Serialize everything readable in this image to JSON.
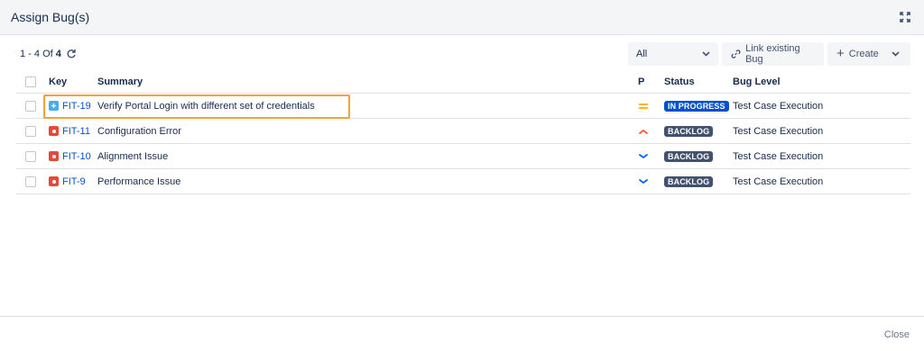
{
  "dialog": {
    "title": "Assign Bug(s)"
  },
  "toolbar": {
    "count_prefix": "1 - 4 Of",
    "count_total": "4",
    "filter_value": "All",
    "link_label": "Link existing Bug",
    "create_label": "Create"
  },
  "table": {
    "headers": {
      "key": "Key",
      "summary": "Summary",
      "p": "P",
      "status": "Status",
      "level": "Bug Level"
    },
    "rows": [
      {
        "key": "FIT-19",
        "summary": "Verify Portal Login with different set of credentials",
        "status": "IN PROGRESS",
        "level": "Test Case Execution",
        "type_icon": "task-icon",
        "priority_icon": "priority-medium-icon"
      },
      {
        "key": "FIT-11",
        "summary": "Configuration Error",
        "status": "BACKLOG",
        "level": "Test Case Execution",
        "type_icon": "bug-icon",
        "priority_icon": "priority-high-icon"
      },
      {
        "key": "FIT-10",
        "summary": "Alignment Issue",
        "status": "BACKLOG",
        "level": "Test Case Execution",
        "type_icon": "bug-icon",
        "priority_icon": "priority-low-icon"
      },
      {
        "key": "FIT-9",
        "summary": "Performance Issue",
        "status": "BACKLOG",
        "level": "Test Case Execution",
        "type_icon": "bug-icon",
        "priority_icon": "priority-low-icon"
      }
    ]
  },
  "footer": {
    "close_label": "Close"
  },
  "colors": {
    "highlight": "#f2a13b",
    "link": "#0052cc",
    "in_progress": "#0052cc",
    "backlog": "#42526e",
    "bug": "#e5493a",
    "priority_medium": "#ffab00",
    "priority_high": "#ff5630",
    "priority_low": "#0065ff"
  }
}
